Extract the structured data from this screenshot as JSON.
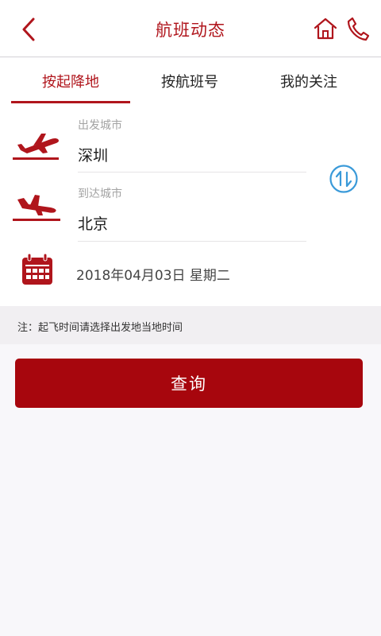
{
  "header": {
    "title": "航班动态",
    "back_icon": "chevron-left-icon",
    "home_icon": "home-icon",
    "phone_icon": "phone-icon"
  },
  "tabs": [
    {
      "label": "按起降地",
      "active": true
    },
    {
      "label": "按航班号",
      "active": false
    },
    {
      "label": "我的关注",
      "active": false
    }
  ],
  "form": {
    "departure": {
      "label": "出发城市",
      "value": "深圳",
      "icon": "plane-takeoff-icon"
    },
    "arrival": {
      "label": "到达城市",
      "value": "北京",
      "icon": "plane-landing-icon"
    },
    "swap_icon": "swap-icon",
    "date": {
      "value": "2018年04月03日 星期二",
      "icon": "calendar-icon"
    }
  },
  "note": "注：起飞时间请选择出发地当地时间",
  "query_button": "查询",
  "colors": {
    "brand": "#a7060d",
    "accent_blue": "#3a9ad9",
    "muted_text": "#a3a3a3",
    "background": "#f8f7fa"
  }
}
